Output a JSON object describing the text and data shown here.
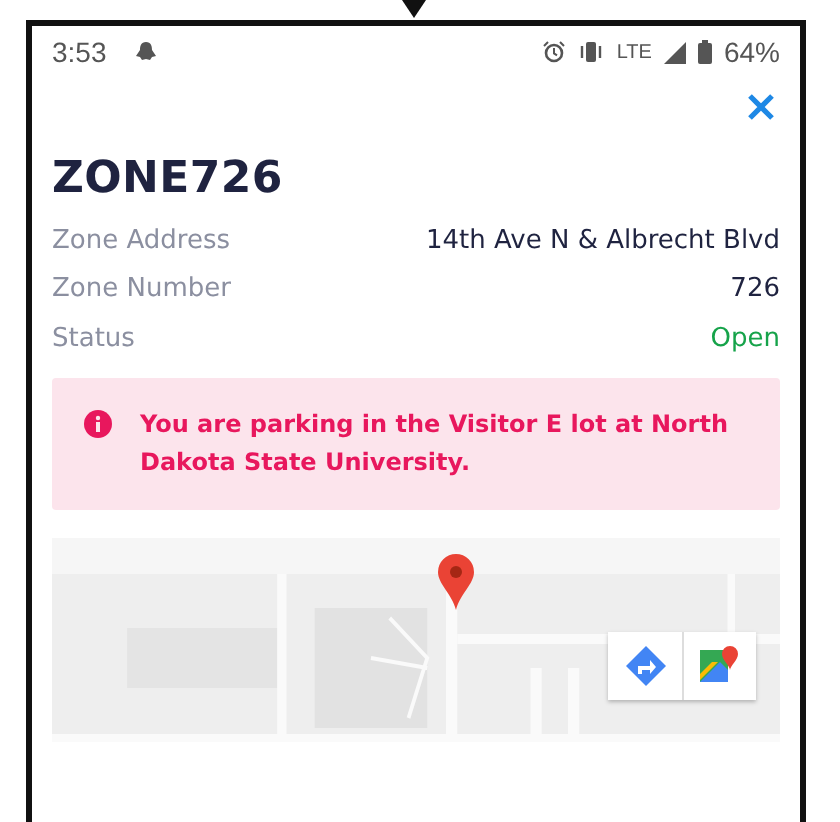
{
  "status_bar": {
    "time": "3:53",
    "network": "LTE",
    "battery": "64%"
  },
  "title": "ZONE726",
  "details": [
    {
      "label": "Zone Address",
      "value": "14th Ave N & Albrecht Blvd",
      "kind": "plain"
    },
    {
      "label": "Zone Number",
      "value": "726",
      "kind": "plain"
    },
    {
      "label": "Status",
      "value": "Open",
      "kind": "status"
    }
  ],
  "alert": {
    "message": "You are parking in the Visitor E lot at North Dakota State University."
  }
}
